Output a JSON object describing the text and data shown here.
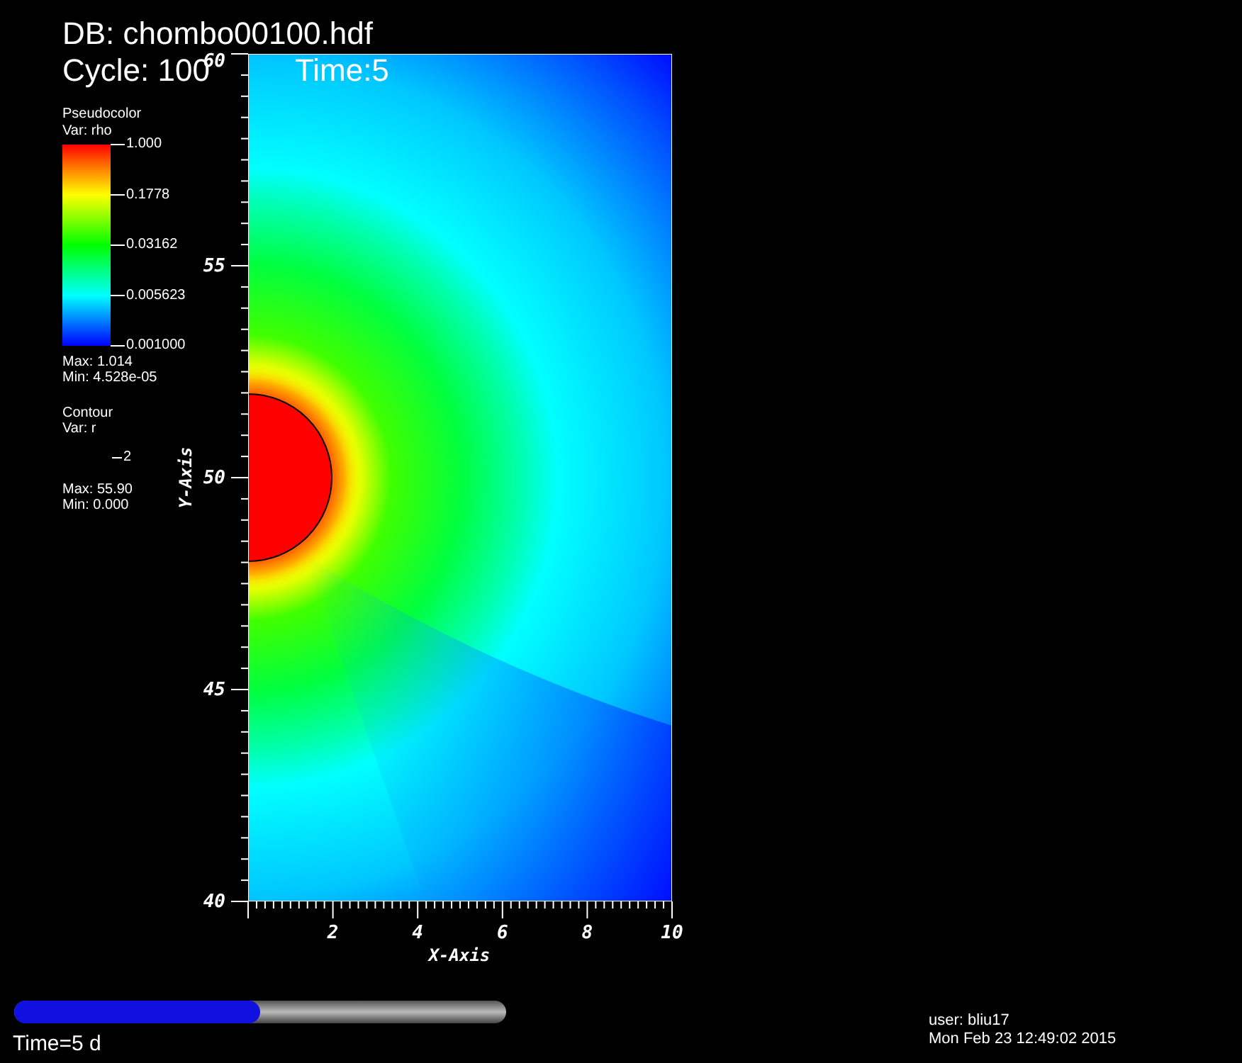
{
  "header": {
    "database": "DB: chombo00100.hdf",
    "cycle": "Cycle: 100",
    "time": "Time:5"
  },
  "pseudocolor_legend": {
    "title": "Pseudocolor",
    "variable": "Var: rho",
    "labels": [
      "1.000",
      "0.1778",
      "0.03162",
      "0.005623",
      "0.001000"
    ],
    "max": "Max:  1.014",
    "min": "Min:  4.528e-05"
  },
  "contour_legend": {
    "title": "Contour",
    "variable": "Var: r",
    "levels": [
      "2"
    ],
    "max": "Max:  55.90",
    "min": "Min:  0.000"
  },
  "x_axis": {
    "title": "X-Axis",
    "ticks": [
      "2",
      "4",
      "6",
      "8",
      "10"
    ]
  },
  "y_axis": {
    "title": "Y-Axis",
    "ticks": [
      "60",
      "55",
      "50",
      "45",
      "40"
    ]
  },
  "time_slider": {
    "level": 0.5,
    "label": "Time=5 d"
  },
  "user": "user: bliu17",
  "date": "Mon Feb 23 12:49:02 2015"
}
